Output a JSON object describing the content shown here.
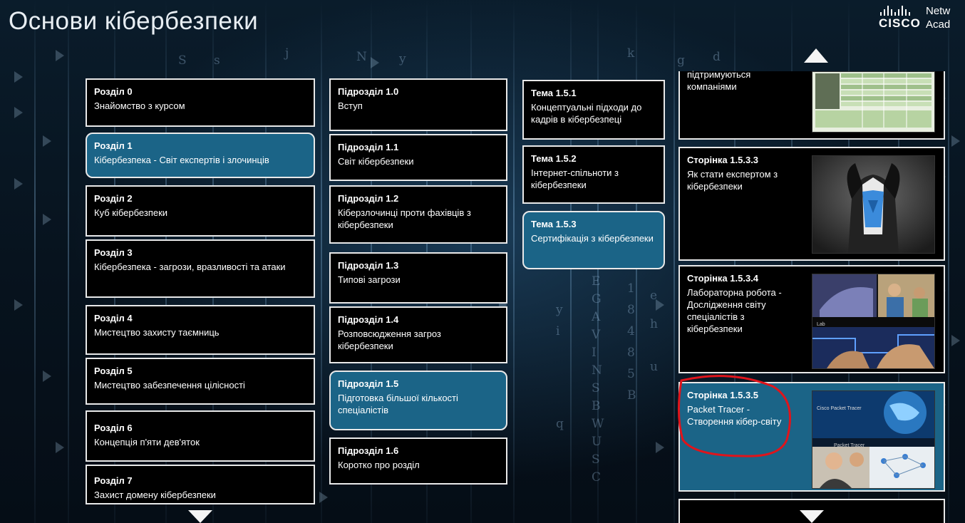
{
  "app": {
    "title": "Основи кібербезпеки",
    "logo": {
      "word": "CISCO",
      "rest_line1": "Netw",
      "rest_line2": "Acad"
    }
  },
  "chapters": [
    {
      "head": "Розділ 0",
      "sub": "Знайомство з курсом"
    },
    {
      "head": "Розділ 1",
      "sub": "Кібербезпека - Світ експертів і злочинців"
    },
    {
      "head": "Розділ 2",
      "sub": "Куб кібербезпеки"
    },
    {
      "head": "Розділ 3",
      "sub": "Кібербезпека - загрози, вразливості та атаки"
    },
    {
      "head": "Розділ 4",
      "sub": "Мистецтво захисту таємниць"
    },
    {
      "head": "Розділ 5",
      "sub": "Мистецтво забезпечення цілісності"
    },
    {
      "head": "Розділ 6",
      "sub": "Концепція п'яти дев'яток"
    },
    {
      "head": "Розділ 7",
      "sub": "Захист домену кібербезпеки"
    }
  ],
  "sections": [
    {
      "head": "Підрозділ 1.0",
      "sub": "Вступ"
    },
    {
      "head": "Підрозділ 1.1",
      "sub": "Світ кібербезпеки"
    },
    {
      "head": "Підрозділ 1.2",
      "sub": "Кіберзлочинці проти фахівців з кібербезпеки"
    },
    {
      "head": "Підрозділ 1.3",
      "sub": "Типові загрози"
    },
    {
      "head": "Підрозділ 1.4",
      "sub": "Розповсюдження загроз кібербезпеки"
    },
    {
      "head": "Підрозділ 1.5",
      "sub": "Підготовка більшої кількості спеціалістів"
    },
    {
      "head": "Підрозділ 1.6",
      "sub": "Коротко про розділ"
    }
  ],
  "topics": [
    {
      "head": "Тема 1.5.1",
      "sub": "Концептуальні підходи до кадрів в кібербезпеці"
    },
    {
      "head": "Тема 1.5.2",
      "sub": "Інтернет-спільноти з кібербезпеки"
    },
    {
      "head": "Тема 1.5.3",
      "sub": "Сертифікація з кібербезпеки"
    }
  ],
  "pages": [
    {
      "head": "",
      "sub": "підтримуються компаніями"
    },
    {
      "head": "Сторінка 1.5.3.3",
      "sub": "Як стати експертом з кібербезпеки"
    },
    {
      "head": "Сторінка 1.5.3.4",
      "sub": "Лабораторна робота - Дослідження світу спеціалістів з кібербезпеки"
    },
    {
      "head": "Сторінка 1.5.3.5",
      "sub": "Packet Tracer - Створення кібер-світу"
    }
  ],
  "thumb_text": {
    "lab_caption": "Lab",
    "pt_title": "Cisco Packet Tracer",
    "pt_caption": "Packet Tracer"
  },
  "colors": {
    "active": "#1b6487",
    "annotation": "#e0141b",
    "card_border": "#e9e9e9"
  }
}
